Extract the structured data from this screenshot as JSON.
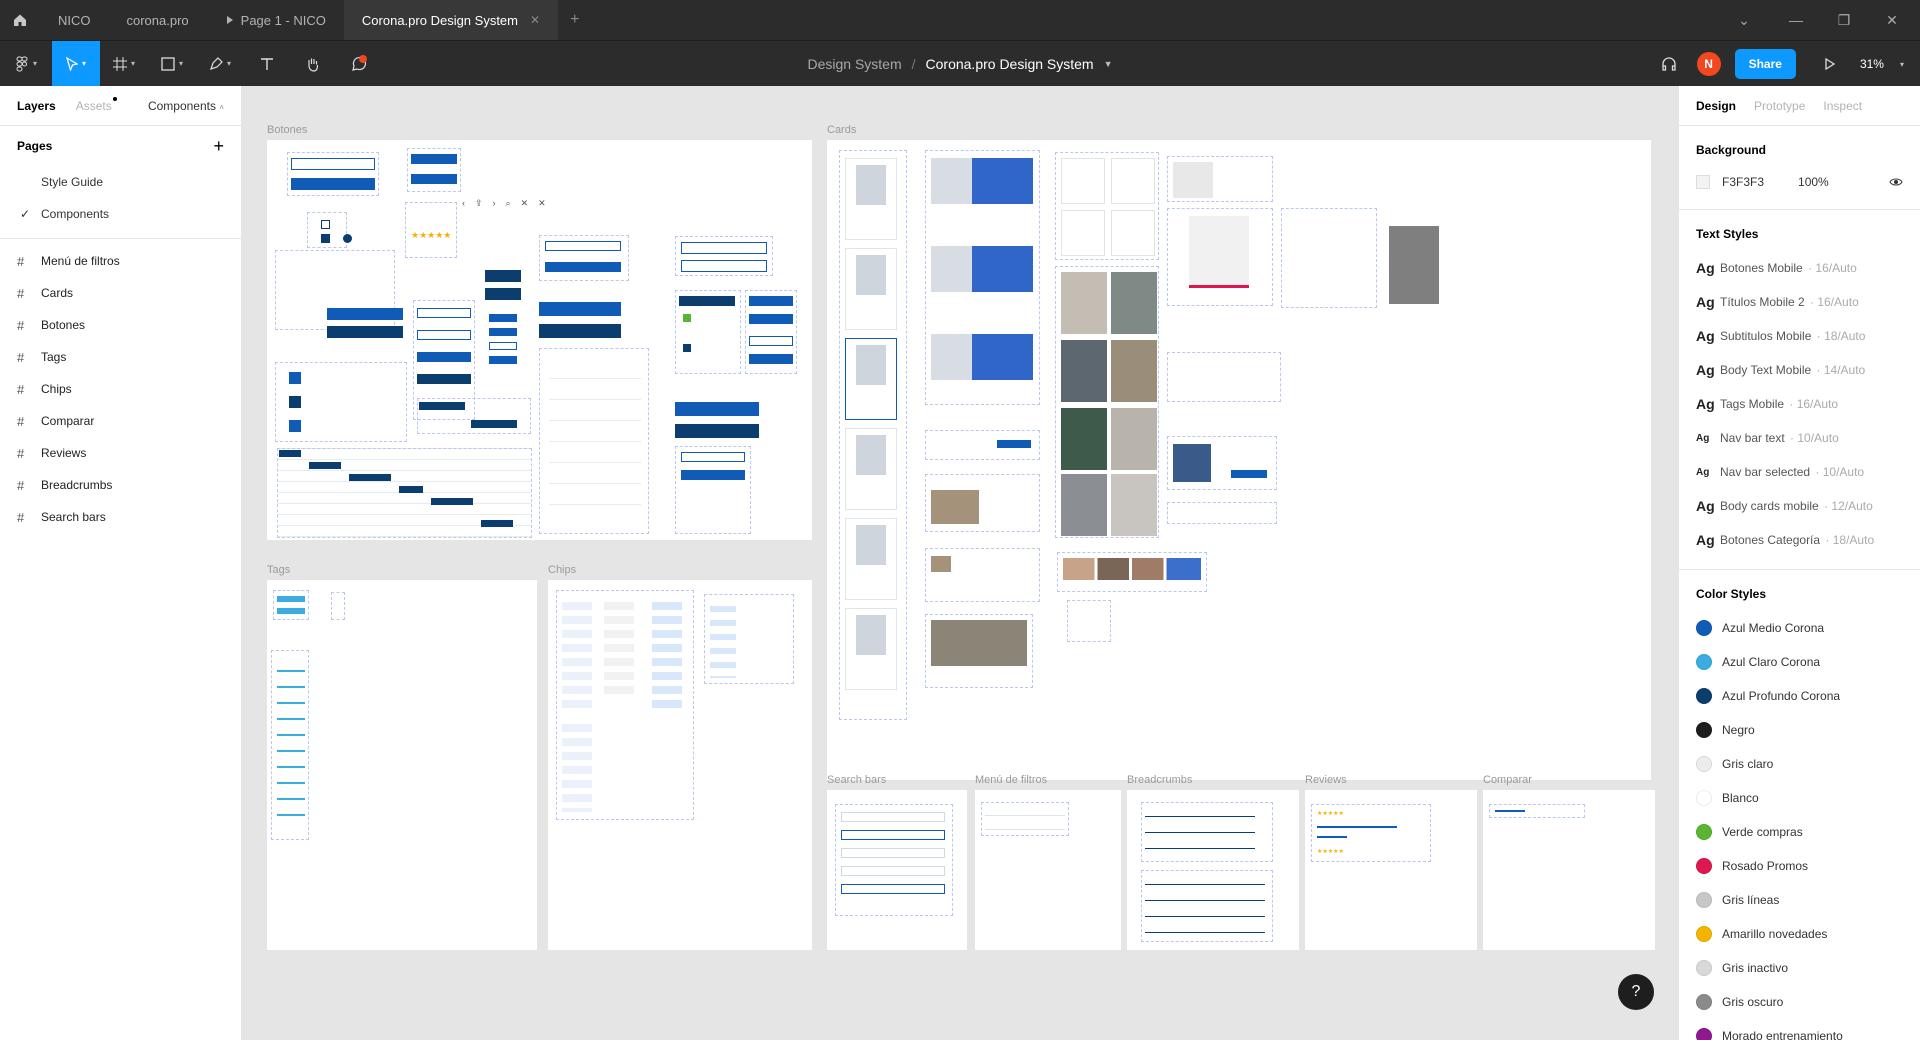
{
  "tabs": [
    {
      "label": "NICO"
    },
    {
      "label": "corona.pro"
    },
    {
      "label": "Page 1 - NICO"
    },
    {
      "label": "Corona.pro Design System"
    }
  ],
  "toolbar": {
    "project": "Design System",
    "file": "Corona.pro Design System",
    "avatar_initial": "N",
    "share_label": "Share",
    "zoom": "31%"
  },
  "left_panel": {
    "tabs": {
      "layers": "Layers",
      "assets": "Assets",
      "components": "Components"
    },
    "pages_title": "Pages",
    "pages": [
      "Style Guide",
      "Components"
    ],
    "layers": [
      "Menú de filtros",
      "Cards",
      "Botones",
      "Tags",
      "Chips",
      "Comparar",
      "Reviews",
      "Breadcrumbs",
      "Search bars"
    ]
  },
  "right_panel": {
    "tabs": {
      "design": "Design",
      "prototype": "Prototype",
      "inspect": "Inspect"
    },
    "background_title": "Background",
    "background_hex": "F3F3F3",
    "background_opacity": "100%",
    "text_styles_title": "Text Styles",
    "text_styles": [
      {
        "name": "Botones Mobile",
        "meta": "16/Auto"
      },
      {
        "name": "Títulos Mobile 2",
        "meta": "16/Auto"
      },
      {
        "name": "Subtitulos Mobile",
        "meta": "18/Auto"
      },
      {
        "name": "Body Text Mobile",
        "meta": "14/Auto"
      },
      {
        "name": "Tags Mobile",
        "meta": "16/Auto"
      },
      {
        "name": "Nav bar text",
        "meta": "10/Auto"
      },
      {
        "name": "Nav bar selected",
        "meta": "10/Auto"
      },
      {
        "name": "Body cards mobile",
        "meta": "12/Auto"
      },
      {
        "name": "Botones Categoría",
        "meta": "18/Auto"
      }
    ],
    "color_styles_title": "Color Styles",
    "color_styles": [
      {
        "name": "Azul Medio Corona",
        "color": "#0f5bb5"
      },
      {
        "name": "Azul Claro Corona",
        "color": "#3aace0"
      },
      {
        "name": "Azul Profundo Corona",
        "color": "#0b3d6e"
      },
      {
        "name": "Negro",
        "color": "#1e1e1e"
      },
      {
        "name": "Gris claro",
        "color": "#ececec"
      },
      {
        "name": "Blanco",
        "color": "#ffffff"
      },
      {
        "name": "Verde compras",
        "color": "#5cb531"
      },
      {
        "name": "Rosado Promos",
        "color": "#e0174f"
      },
      {
        "name": "Gris líneas",
        "color": "#c7c7c7"
      },
      {
        "name": "Amarillo novedades",
        "color": "#f4b400"
      },
      {
        "name": "Gris inactivo",
        "color": "#d9d9d9"
      },
      {
        "name": "Gris oscuro",
        "color": "#8a8a8a"
      },
      {
        "name": "Morado entrenamiento",
        "color": "#8e1a8e"
      }
    ]
  },
  "canvas": {
    "frames": {
      "botones": "Botones",
      "cards": "Cards",
      "tags": "Tags",
      "chips": "Chips",
      "search_bars": "Search bars",
      "menu_filtros": "Menú de filtros",
      "breadcrumbs": "Breadcrumbs",
      "reviews": "Reviews",
      "comparar": "Comparar"
    }
  },
  "help_label": "?"
}
